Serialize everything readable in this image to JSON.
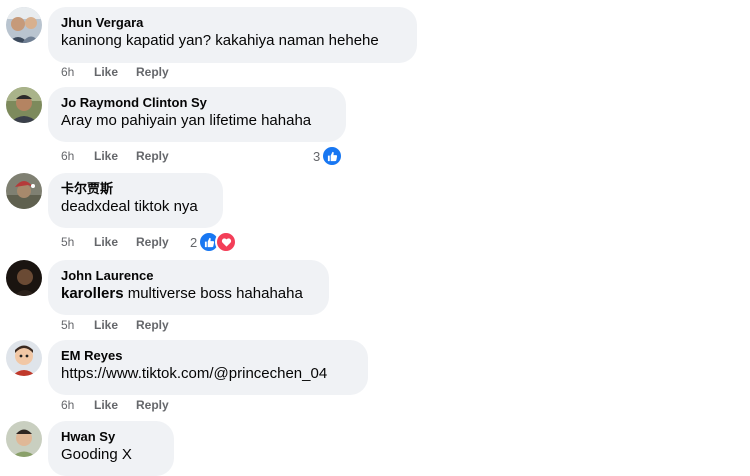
{
  "comments": [
    {
      "author": "Jhun Vergara",
      "text": "kaninong kapatid yan? kakahiya naman hehehe",
      "time": "6h",
      "like": "Like",
      "reply": "Reply"
    },
    {
      "author": "Jo Raymond Clinton Sy",
      "text": "Aray mo pahiyain yan lifetime hahaha",
      "time": "6h",
      "like": "Like",
      "reply": "Reply",
      "reaction_count": "3"
    },
    {
      "author": "卡尔贾斯",
      "text": "deadxdeal tiktok nya",
      "time": "5h",
      "like": "Like",
      "reply": "Reply",
      "reaction_count": "2"
    },
    {
      "author": "John Laurence",
      "mention": "karollers",
      "text": " multiverse boss hahahaha",
      "time": "5h",
      "like": "Like",
      "reply": "Reply"
    },
    {
      "author": "EM Reyes",
      "text": "https://www.tiktok.com/@princechen_04",
      "time": "6h",
      "like": "Like",
      "reply": "Reply"
    },
    {
      "author": "Hwan Sy",
      "text": "Gooding X"
    }
  ],
  "colors": {
    "bubble": "#f0f2f5",
    "meta": "#65676b",
    "like_reaction": "#1877f2",
    "love_reaction": "#f33e58"
  }
}
